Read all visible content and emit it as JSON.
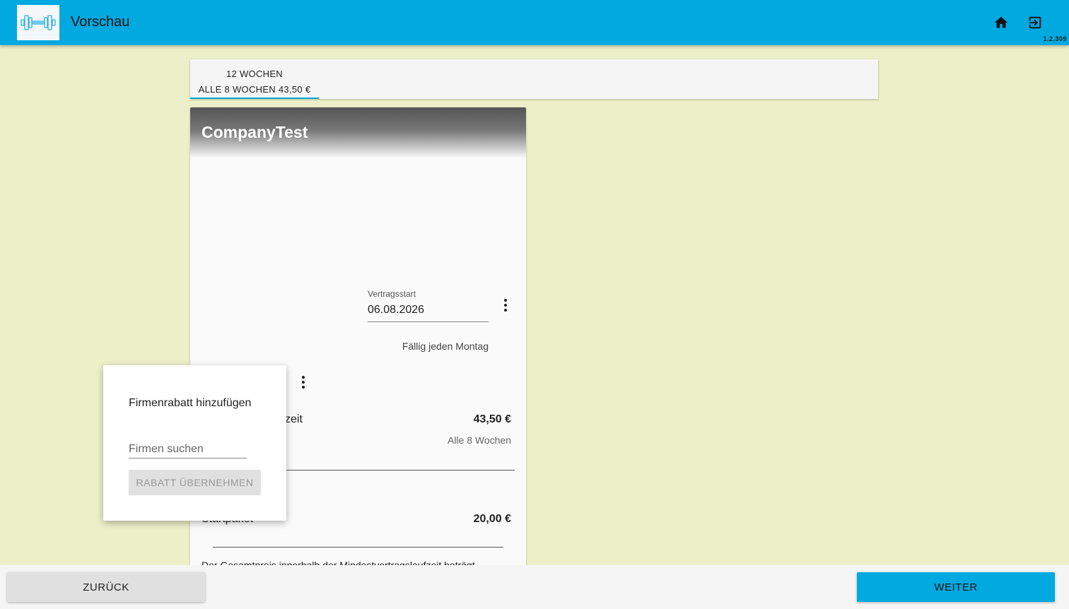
{
  "appbar": {
    "title": "Vorschau",
    "version": "1.2.309",
    "logo_icon": "dumbbell-icon",
    "home_icon": "home-icon",
    "exit_icon": "logout-icon"
  },
  "tabs": [
    {
      "line1": "12 WOCHEN",
      "line2": "ALLE 8 WOCHEN 43,50 €",
      "selected": true
    }
  ],
  "card": {
    "title": "CompanyTest",
    "contract_start_label": "Vertragsstart",
    "contract_start_value": "06.08.2026",
    "due_text": "Fällig jeden Montag",
    "membership_label_partial": "zeit",
    "membership_price": "43,50 €",
    "membership_interval": "Alle 8 Wochen",
    "starter_label": "Startpaket",
    "starter_price": "20,00 €",
    "summary_text": "Der Gesamtpreis innerhalb der Mindestvertragslaufzeit beträgt"
  },
  "popup": {
    "title": "Firmenrabatt hinzufügen",
    "search_placeholder": "Firmen suchen",
    "search_value": "",
    "apply_button": "RABATT ÜBERNEHMEN"
  },
  "footer": {
    "back_button": "ZURÜCK",
    "next_button": "WEITER"
  },
  "colors": {
    "primary": "#00a9e0",
    "background": "#ebf0c8",
    "card": "#fafafa"
  }
}
